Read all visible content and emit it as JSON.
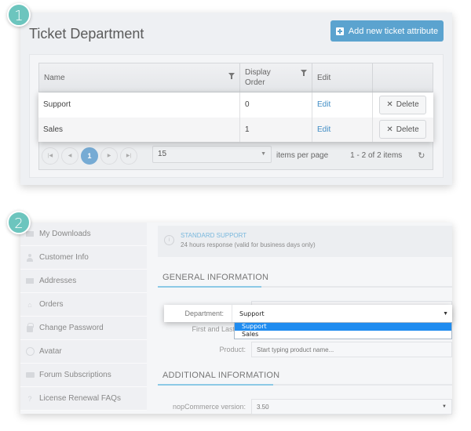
{
  "badges": [
    "1",
    "2"
  ],
  "panel1": {
    "title": "Ticket Department",
    "add_button": "Add new ticket attribute",
    "grid": {
      "columns": [
        "Name",
        "Display Order",
        "Edit",
        ""
      ],
      "rows": [
        {
          "name": "Support",
          "display_order": "0",
          "edit": "Edit",
          "delete": "Delete"
        },
        {
          "name": "Sales",
          "display_order": "1",
          "edit": "Edit",
          "delete": "Delete"
        }
      ],
      "pager": {
        "current_page": "1",
        "page_size": "15",
        "items_per_page_label": "items per page",
        "count_label": "1 - 2 of 2 items"
      }
    }
  },
  "panel2": {
    "sidebar": [
      {
        "label": "My Downloads",
        "icon": "download-icon"
      },
      {
        "label": "Customer Info",
        "icon": "person-icon"
      },
      {
        "label": "Addresses",
        "icon": "address-card-icon"
      },
      {
        "label": "Orders",
        "icon": "basket-icon"
      },
      {
        "label": "Change Password",
        "icon": "lock-icon"
      },
      {
        "label": "Avatar",
        "icon": "avatar-icon"
      },
      {
        "label": "Forum Subscriptions",
        "icon": "chat-bubbles-icon"
      },
      {
        "label": "License Renewal FAQs",
        "icon": "question-icon"
      }
    ],
    "info": {
      "title": "STANDARD SUPPORT",
      "description": "24 hours response (valid for business days only)"
    },
    "general_section": "GENERAL INFORMATION",
    "additional_section": "ADDITIONAL INFORMATION",
    "department": {
      "label": "Department:",
      "value": "Support",
      "options": [
        "Support",
        "Sales"
      ],
      "selected_option": "Support"
    },
    "name_label": "First and Last Na",
    "product": {
      "label": "Product:",
      "placeholder": "Start typing product name..."
    },
    "version": {
      "label": "nopCommerce version:",
      "value": "3.50"
    }
  },
  "colors": {
    "accent": "#5ba3cf",
    "badge": "#6cc5be",
    "link": "#3f8cc5",
    "selected_option": "#1f8cf0"
  }
}
